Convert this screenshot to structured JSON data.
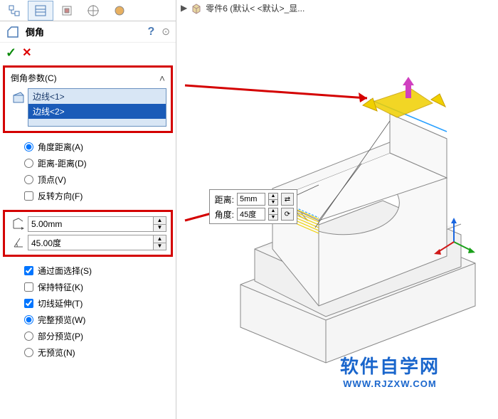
{
  "breadcrumb": {
    "part_label": "零件6 (默认< <默认>_显..."
  },
  "feature": {
    "title": "倒角"
  },
  "group": {
    "title": "倒角参数(C)"
  },
  "selection": {
    "items": [
      "边线<1>",
      "边线<2>"
    ]
  },
  "options": {
    "angle_distance": "角度距离(A)",
    "distance_distance": "距离-距离(D)",
    "vertex": "顶点(V)",
    "flip": "反转方向(F)",
    "through_face": "通过面选择(S)",
    "keep_feature": "保持特征(K)",
    "tangent_prop": "切线延伸(T)",
    "full_preview": "完整预览(W)",
    "partial_preview": "部分预览(P)",
    "no_preview": "无预览(N)"
  },
  "params": {
    "distance": "5.00mm",
    "angle": "45.00度"
  },
  "callout": {
    "distance_label": "距离:",
    "distance_val": "5mm",
    "angle_label": "角度:",
    "angle_val": "45度"
  },
  "watermark": {
    "cn": "软件自学网",
    "en": "WWW.RJZXW.COM"
  }
}
